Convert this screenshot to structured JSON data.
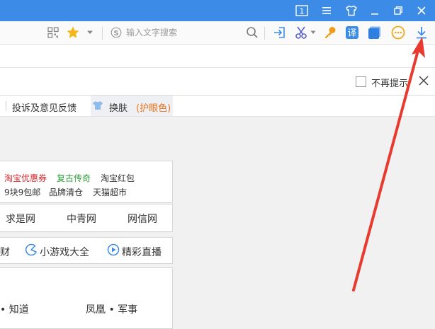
{
  "titlebar": {
    "color": "#3c8ce7",
    "buttons": [
      {
        "name": "tab-count-button",
        "label": "1"
      },
      {
        "name": "menu-icon"
      },
      {
        "name": "skin-shirt-icon"
      },
      {
        "name": "minimize-icon"
      },
      {
        "name": "restore-icon"
      },
      {
        "name": "close-icon"
      }
    ]
  },
  "toolbar": {
    "search_placeholder": "输入文字搜索",
    "icons": [
      "qr-code-icon",
      "star-icon",
      "dropdown-icon",
      "search-engine-icon",
      "search-icon",
      "login-icon",
      "scissors-icon",
      "key-icon",
      "translate-icon",
      "screenshot-icon",
      "more-icon",
      "download-icon"
    ],
    "translate_char": "译"
  },
  "notify": {
    "checkbox_label": "不再提示"
  },
  "links": {
    "feedback": "投诉及意见反馈",
    "skin_label": "换肤",
    "skin_mode": "(护眼色)",
    "skin_mode_color": "#e8741c"
  },
  "shop": {
    "row1": [
      {
        "text": "淘宝优惠券",
        "color": "#d8282c"
      },
      {
        "text": "复古传奇",
        "color": "#2f9c3e"
      },
      {
        "text": "淘宝红包",
        "color": "#333333"
      }
    ],
    "row2": [
      {
        "text": "9块9包邮"
      },
      {
        "text": "品牌清仓"
      },
      {
        "text": "天猫超市"
      }
    ]
  },
  "sites": [
    "求是网",
    "中青网",
    "网信网"
  ],
  "tools": [
    {
      "text": "财"
    },
    {
      "text": "小游戏大全",
      "icon": "pacman-icon"
    },
    {
      "text": "精彩直播",
      "icon": "play-icon"
    }
  ],
  "news": [
    "• 知道",
    "凤凰 • 军事"
  ],
  "annotation": {
    "arrow_color": "#e83a2f"
  }
}
